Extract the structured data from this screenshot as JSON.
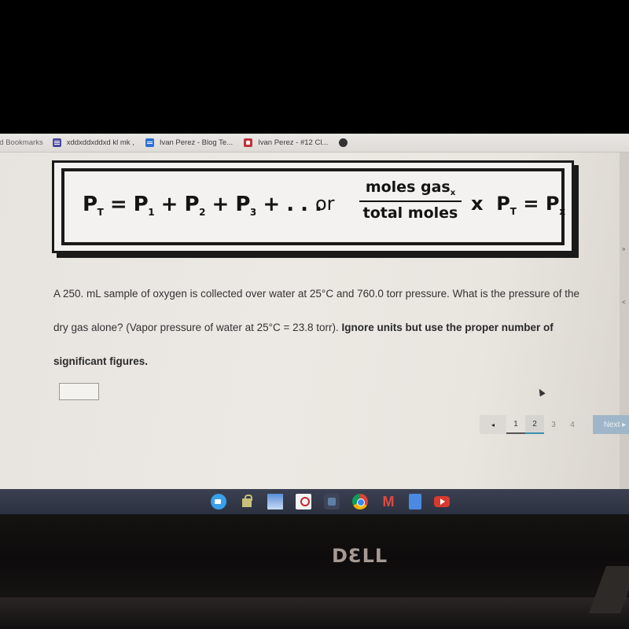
{
  "bookmarks_bar": {
    "items": [
      {
        "label": "ed Bookmarks",
        "icon": "bookmarks-folder"
      },
      {
        "label": "xddxddxddxd kl mk ,",
        "icon": "forms-icon"
      },
      {
        "label": "Ivan Perez - Blog Te...",
        "icon": "docs-icon"
      },
      {
        "label": "Ivan Perez - #12 Cl...",
        "icon": "red-app-icon"
      },
      {
        "label": "",
        "icon": "globe-icon"
      }
    ]
  },
  "formula": {
    "eq1_text": "Pₜ = P₁ + P₂ + P₃ + . . .",
    "eq1": {
      "p": "P",
      "t": "T",
      "p1": "1",
      "p2": "2",
      "p3": "3",
      "eq": "=",
      "plus": "+",
      "ellipsis": ". . ."
    },
    "or": "or",
    "numerator": "moles gas",
    "numerator_sub": "x",
    "denominator": "total moles",
    "eq2": {
      "times": "x",
      "p": "P",
      "t": "T",
      "eq": "=",
      "x": "x"
    }
  },
  "question": {
    "text": "A 250. mL sample of oxygen is collected over water at 25°C and 760.0 torr pressure.  What is the pressure of the dry gas alone? (Vapor pressure of water at 25°C = 23.8 torr).",
    "bold_text": "Ignore units but use the proper number of significant figures."
  },
  "answer": {
    "value": "",
    "placeholder": ""
  },
  "pagination": {
    "prev": "◂",
    "pages": [
      "1",
      "2",
      "3",
      "4"
    ],
    "current_page": "2",
    "next": "Next ▸"
  },
  "shelf": {
    "apps": [
      "zoom",
      "lock-app",
      "figure-app",
      "screencast",
      "files",
      "chrome",
      "gmail",
      "google-docs",
      "youtube"
    ],
    "gmail_glyph": "M"
  },
  "right_panel": {
    "glyphs": [
      "»",
      "<"
    ]
  },
  "brand": "DƐLL"
}
